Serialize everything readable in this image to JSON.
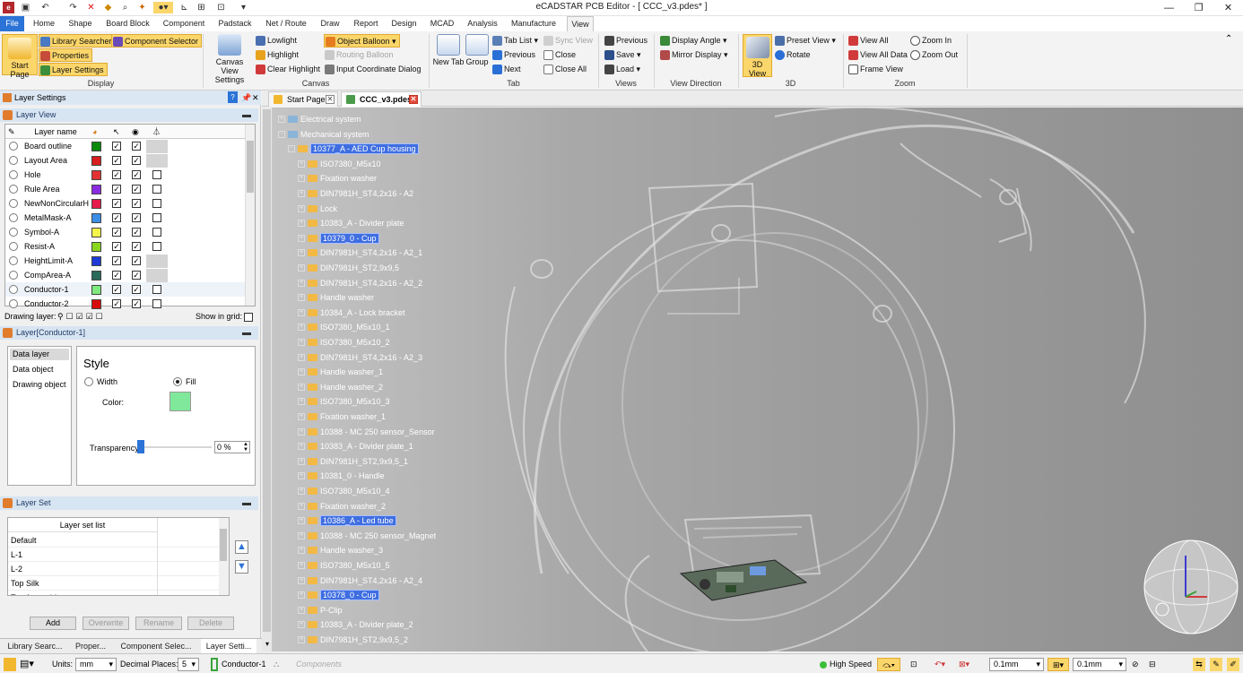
{
  "app": {
    "title": "eCADSTAR PCB Editor - [ CCC_v3.pdes* ]"
  },
  "menu_tabs": [
    "File",
    "Home",
    "Shape",
    "Board Block",
    "Component",
    "Padstack",
    "Net / Route",
    "Draw",
    "Report",
    "Design",
    "MCAD",
    "Analysis",
    "Manufacture",
    "View"
  ],
  "active_tab": "View",
  "ribbon": {
    "display": {
      "label": "Display",
      "start_page": "Start Page",
      "library_searcher": "Library Searcher",
      "component_selector": "Component Selector",
      "properties": "Properties",
      "layer_settings": "Layer Settings"
    },
    "canvas": {
      "label": "Canvas",
      "canvas_view_settings": "Canvas View Settings",
      "lowlight": "Lowlight",
      "highlight": "Highlight",
      "clear_highlight": "Clear Highlight",
      "object_balloon": "Object Balloon",
      "routing_balloon": "Routing Balloon",
      "input_coordinate_dialog": "Input Coordinate Dialog"
    },
    "tab": {
      "label": "Tab",
      "new_tab": "New Tab",
      "group": "Group",
      "tab_list": "Tab List",
      "sync_view": "Sync View",
      "previous": "Previous",
      "next": "Next",
      "close": "Close",
      "close_all": "Close All"
    },
    "views": {
      "label": "Views",
      "previous": "Previous",
      "save": "Save",
      "load": "Load"
    },
    "view_direction": {
      "label": "View Direction",
      "display_angle": "Display Angle",
      "mirror_display": "Mirror Display"
    },
    "threed": {
      "label": "3D",
      "view_3d": "3D View",
      "preset_view": "Preset View",
      "rotate": "Rotate"
    },
    "zoom": {
      "label": "Zoom",
      "view_all": "View All",
      "view_all_data": "View All Data",
      "frame_view": "Frame View",
      "zoom_in": "Zoom In",
      "zoom_out": "Zoom Out"
    }
  },
  "layer_settings": {
    "title": "Layer Settings",
    "layer_view": {
      "title": "Layer View",
      "col_name": "Layer name",
      "layers": [
        {
          "name": "Board outline",
          "color": "#0a8a0a",
          "sel": true,
          "vis": true,
          "grid": null
        },
        {
          "name": "Layout Area",
          "color": "#d81e1e",
          "sel": true,
          "vis": true,
          "grid": null
        },
        {
          "name": "Hole",
          "color": "#e23232",
          "sel": true,
          "vis": true,
          "grid": false
        },
        {
          "name": "Rule Area",
          "color": "#8a2be2",
          "sel": true,
          "vis": true,
          "grid": false
        },
        {
          "name": "NewNonCircularH",
          "color": "#e6194b",
          "sel": true,
          "vis": true,
          "grid": false
        },
        {
          "name": "MetalMask-A",
          "color": "#3c8ee6",
          "sel": true,
          "vis": true,
          "grid": false
        },
        {
          "name": "Symbol-A",
          "color": "#f4f44a",
          "sel": true,
          "vis": true,
          "grid": false
        },
        {
          "name": "Resist-A",
          "color": "#8ad61e",
          "sel": true,
          "vis": true,
          "grid": false
        },
        {
          "name": "HeightLimit-A",
          "color": "#1f3bd6",
          "sel": true,
          "vis": true,
          "grid": null
        },
        {
          "name": "CompArea-A",
          "color": "#2a6a5a",
          "sel": true,
          "vis": true,
          "grid": null
        },
        {
          "name": "Conductor-1",
          "color": "#7fe87f",
          "sel": true,
          "vis": true,
          "grid": false
        },
        {
          "name": "Conductor-2",
          "color": "#d80c0c",
          "sel": true,
          "vis": true,
          "grid": false
        }
      ],
      "drawing_layer_label": "Drawing layer:",
      "show_in_grid_label": "Show in grid:"
    },
    "layer_detail": {
      "title": "Layer[Conductor-1]",
      "tree": [
        "Data layer",
        "Data object",
        "Drawing object"
      ],
      "style_title": "Style",
      "width_label": "Width",
      "fill_label": "Fill",
      "color_label": "Color:",
      "color": "#7fe89a",
      "transparency_label": "Transparency",
      "transparency_value": "0 %",
      "transparency": 0
    },
    "layer_set": {
      "title": "Layer Set",
      "list_header": "Layer set list",
      "items": [
        "Default",
        "L-1",
        "L-2",
        "Top Silk",
        "Top Assembly"
      ],
      "add": "Add",
      "overwrite": "Overwrite",
      "rename": "Rename",
      "delete": "Delete"
    }
  },
  "bottom_tabs": [
    "Library Searc...",
    "Proper...",
    "Component Selec...",
    "Layer Setti..."
  ],
  "doc_tabs": [
    {
      "label": "Start Page"
    },
    {
      "label": "CCC_v3.pdes*"
    }
  ],
  "tree": [
    {
      "label": "Electrical system",
      "level": 0,
      "exp": "+",
      "sel": false
    },
    {
      "label": "Mechanical system",
      "level": 0,
      "exp": "-",
      "sel": false
    },
    {
      "label": "10377_A - AED Cup housing",
      "level": 1,
      "exp": "-",
      "sel": true
    },
    {
      "label": "ISO7380_M5x10",
      "level": 2,
      "exp": "+",
      "sel": false
    },
    {
      "label": "Fixation washer",
      "level": 2,
      "exp": "+",
      "sel": false
    },
    {
      "label": "DIN7981H_ST4,2x16 - A2",
      "level": 2,
      "exp": "+",
      "sel": false
    },
    {
      "label": "Lock",
      "level": 2,
      "exp": "+",
      "sel": false
    },
    {
      "label": "10383_A - Divider plate",
      "level": 2,
      "exp": "+",
      "sel": false
    },
    {
      "label": "10379_0 - Cup",
      "level": 2,
      "exp": "+",
      "sel": true
    },
    {
      "label": "DIN7981H_ST4,2x16 - A2_1",
      "level": 2,
      "exp": "+",
      "sel": false
    },
    {
      "label": "DIN7981H_ST2,9x9,5",
      "level": 2,
      "exp": "+",
      "sel": false
    },
    {
      "label": "DIN7981H_ST4,2x16 - A2_2",
      "level": 2,
      "exp": "+",
      "sel": false
    },
    {
      "label": "Handle washer",
      "level": 2,
      "exp": "+",
      "sel": false
    },
    {
      "label": "10384_A - Lock bracket",
      "level": 2,
      "exp": "+",
      "sel": false
    },
    {
      "label": "ISO7380_M5x10_1",
      "level": 2,
      "exp": "+",
      "sel": false
    },
    {
      "label": "ISO7380_M5x10_2",
      "level": 2,
      "exp": "+",
      "sel": false
    },
    {
      "label": "DIN7981H_ST4,2x16 - A2_3",
      "level": 2,
      "exp": "+",
      "sel": false
    },
    {
      "label": "Handle washer_1",
      "level": 2,
      "exp": "+",
      "sel": false
    },
    {
      "label": "Handle washer_2",
      "level": 2,
      "exp": "+",
      "sel": false
    },
    {
      "label": "ISO7380_M5x10_3",
      "level": 2,
      "exp": "+",
      "sel": false
    },
    {
      "label": "Fixation washer_1",
      "level": 2,
      "exp": "+",
      "sel": false
    },
    {
      "label": "10388 - MC 250 sensor_Sensor",
      "level": 2,
      "exp": "+",
      "sel": false
    },
    {
      "label": "10383_A - Divider plate_1",
      "level": 2,
      "exp": "+",
      "sel": false
    },
    {
      "label": "DIN7981H_ST2,9x9,5_1",
      "level": 2,
      "exp": "+",
      "sel": false
    },
    {
      "label": "10381_0 - Handle",
      "level": 2,
      "exp": "+",
      "sel": false
    },
    {
      "label": "ISO7380_M5x10_4",
      "level": 2,
      "exp": "+",
      "sel": false
    },
    {
      "label": "Fixation washer_2",
      "level": 2,
      "exp": "+",
      "sel": false
    },
    {
      "label": "10386_A - Led tube",
      "level": 2,
      "exp": "+",
      "sel": true
    },
    {
      "label": "10388 - MC 250 sensor_Magnet",
      "level": 2,
      "exp": "+",
      "sel": false
    },
    {
      "label": "Handle washer_3",
      "level": 2,
      "exp": "+",
      "sel": false
    },
    {
      "label": "ISO7380_M5x10_5",
      "level": 2,
      "exp": "+",
      "sel": false
    },
    {
      "label": "DIN7981H_ST4,2x16 - A2_4",
      "level": 2,
      "exp": "+",
      "sel": false
    },
    {
      "label": "10378_0 - Cup",
      "level": 2,
      "exp": "+",
      "sel": true
    },
    {
      "label": "P-Clip",
      "level": 2,
      "exp": "+",
      "sel": false
    },
    {
      "label": "10383_A - Divider plate_2",
      "level": 2,
      "exp": "+",
      "sel": false
    },
    {
      "label": "DIN7981H_ST2,9x9,5_2",
      "level": 2,
      "exp": "+",
      "sel": false
    }
  ],
  "status": {
    "units_label": "Units:",
    "units": "mm",
    "decimal_label": "Decimal Places:",
    "decimal": "5",
    "layer": "Conductor-1",
    "components": "Components",
    "mode": "High Speed",
    "grid1": "0.1mm",
    "grid2": "0.1mm"
  }
}
